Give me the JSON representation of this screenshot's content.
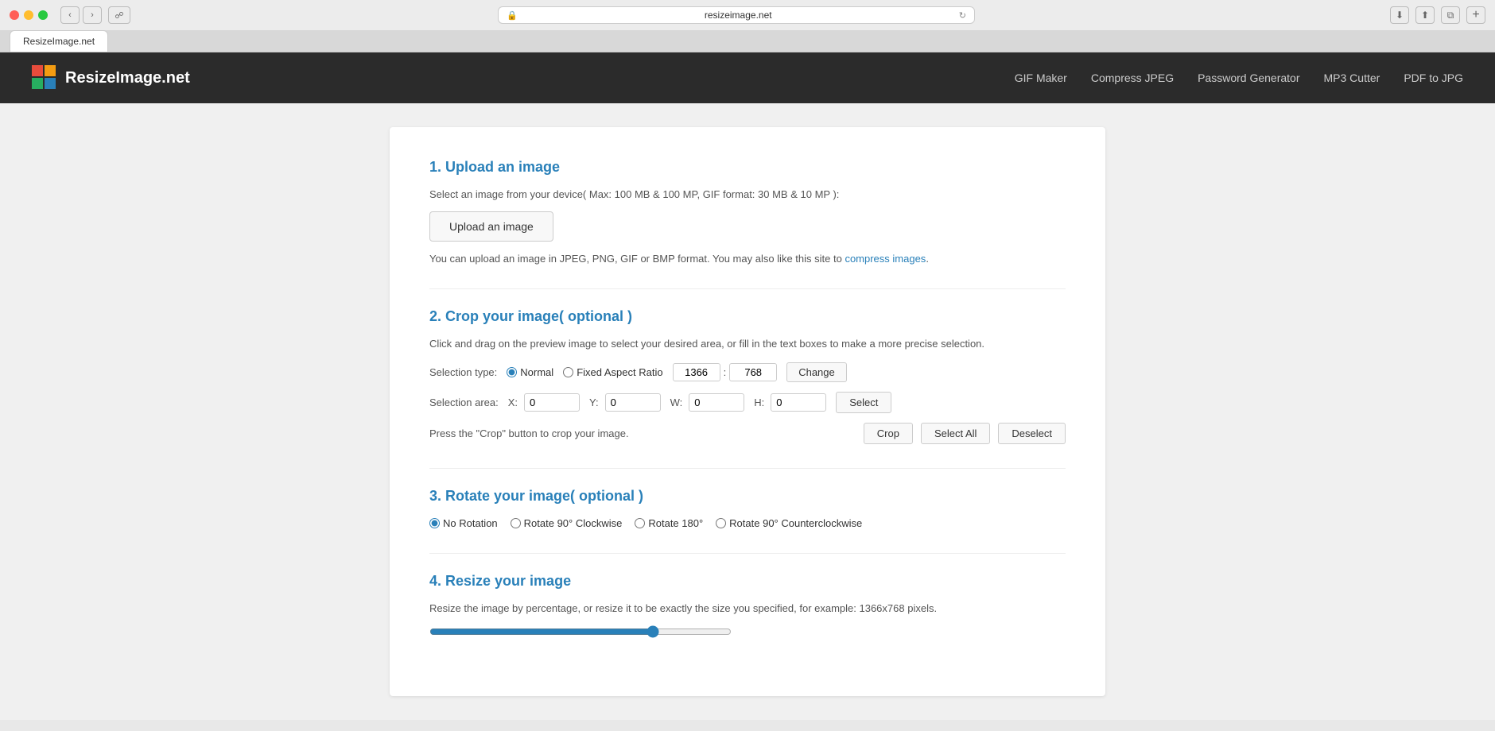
{
  "browser": {
    "url": "resizeimage.net",
    "tab_label": "ResizeImage.net",
    "reload_title": "Reload"
  },
  "navbar": {
    "logo_text": "ResizeImage.net",
    "links": [
      {
        "label": "GIF Maker",
        "id": "gif-maker"
      },
      {
        "label": "Compress JPEG",
        "id": "compress-jpeg"
      },
      {
        "label": "Password Generator",
        "id": "password-generator"
      },
      {
        "label": "MP3 Cutter",
        "id": "mp3-cutter"
      },
      {
        "label": "PDF to JPG",
        "id": "pdf-to-jpg"
      }
    ]
  },
  "step1": {
    "heading": "1. Upload an image",
    "description": "Select an image from your device( Max: 100 MB & 100 MP, GIF format: 30 MB & 10 MP ):",
    "upload_button": "Upload an image",
    "note_before": "You can upload an image in JPEG, PNG, GIF or BMP format. You may also like this site to ",
    "note_link": "compress images",
    "note_after": "."
  },
  "step2": {
    "heading": "2. Crop your image( optional )",
    "description": "Click and drag on the preview image to select your desired area, or fill in the text boxes to make a more precise selection.",
    "selection_type_label": "Selection type:",
    "radio_normal": "Normal",
    "radio_fixed": "Fixed Aspect Ratio",
    "aspect_width": "1366",
    "aspect_height": "768",
    "aspect_separator": ":",
    "change_button": "Change",
    "selection_area_label": "Selection area:",
    "x_label": "X:",
    "x_value": "0",
    "y_label": "Y:",
    "y_value": "0",
    "w_label": "W:",
    "w_value": "0",
    "h_label": "H:",
    "h_value": "0",
    "select_button": "Select",
    "crop_note": "Press the \"Crop\" button to crop your image.",
    "crop_button": "Crop",
    "select_all_button": "Select All",
    "deselect_button": "Deselect"
  },
  "step3": {
    "heading": "3. Rotate your image( optional )",
    "options": [
      {
        "label": "No Rotation",
        "value": "none",
        "checked": true
      },
      {
        "label": "Rotate 90° Clockwise",
        "value": "cw90",
        "checked": false
      },
      {
        "label": "Rotate 180°",
        "value": "180",
        "checked": false
      },
      {
        "label": "Rotate 90° Counterclockwise",
        "value": "ccw90",
        "checked": false
      }
    ]
  },
  "step4": {
    "heading": "4. Resize your image",
    "description": "Resize the image by percentage, or resize it to be exactly the size you specified, for example: 1366x768 pixels.",
    "slider_value": 75
  }
}
